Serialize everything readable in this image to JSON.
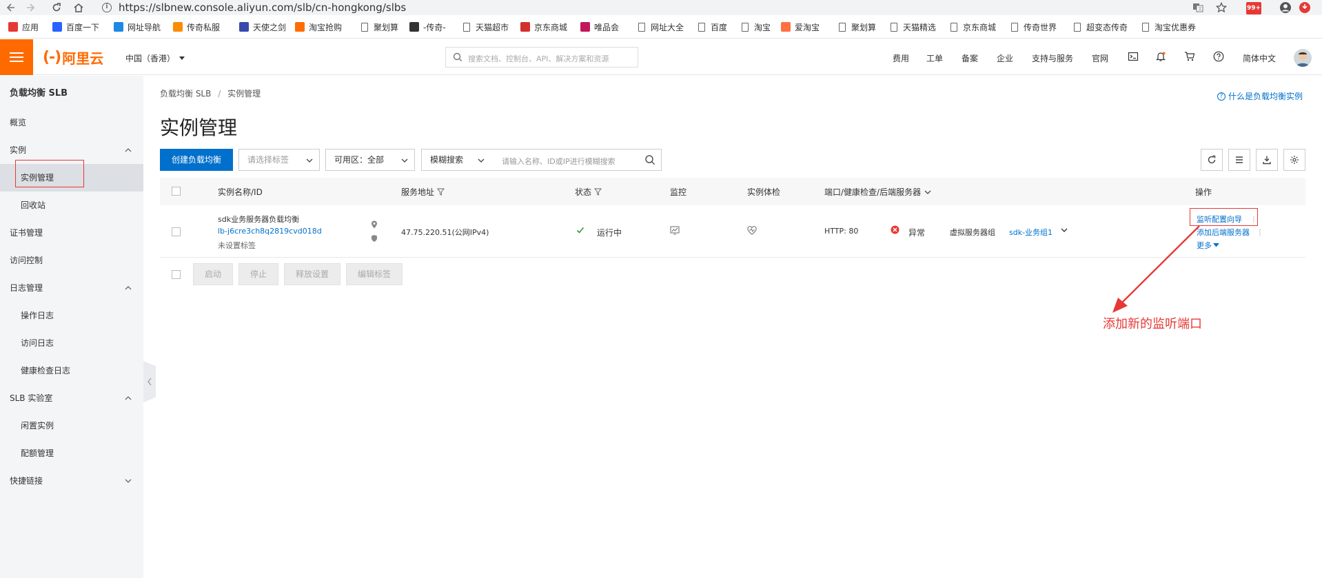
{
  "browser": {
    "url": "https://slbnew.console.aliyun.com/slb/cn-hongkong/slbs",
    "notification_badge": "99+",
    "bookmarks": [
      {
        "label": "应用",
        "icon": "apps-grid-icon",
        "color": "#e53935"
      },
      {
        "label": "百度一下",
        "icon": "baidu-icon",
        "color": "#2962ff"
      },
      {
        "label": "网址导航",
        "icon": "nav-site-icon",
        "color": "#1e88e5"
      },
      {
        "label": "传奇私服",
        "icon": "game-icon",
        "color": "#fb8c00"
      },
      {
        "label": "天使之剑",
        "icon": "angel-icon",
        "color": "#3949ab"
      },
      {
        "label": "淘宝抢购",
        "icon": "taobao-icon",
        "color": "#ff6d00"
      },
      {
        "label": "聚划算",
        "icon": "page-icon",
        "color": ""
      },
      {
        "label": "-传奇-",
        "icon": "legend-icon",
        "color": "#333333"
      },
      {
        "label": "天猫超市",
        "icon": "page-icon",
        "color": ""
      },
      {
        "label": "京东商城",
        "icon": "jd-icon",
        "color": "#d32f2f"
      },
      {
        "label": "唯品会",
        "icon": "vip-icon",
        "color": "#c2185b"
      },
      {
        "label": "网址大全",
        "icon": "page-icon",
        "color": ""
      },
      {
        "label": "百度",
        "icon": "page-icon",
        "color": ""
      },
      {
        "label": "淘宝",
        "icon": "page-icon",
        "color": ""
      },
      {
        "label": "爱淘宝",
        "icon": "aitaobao-icon",
        "color": "#ff7043"
      },
      {
        "label": "聚划算",
        "icon": "page-icon",
        "color": ""
      },
      {
        "label": "天猫精选",
        "icon": "page-icon",
        "color": ""
      },
      {
        "label": "京东商城",
        "icon": "page-icon",
        "color": ""
      },
      {
        "label": "传奇世界",
        "icon": "page-icon",
        "color": ""
      },
      {
        "label": "超变态传奇",
        "icon": "page-icon",
        "color": ""
      },
      {
        "label": "淘宝优惠券",
        "icon": "page-icon",
        "color": ""
      }
    ]
  },
  "header": {
    "logo_text": "阿里云",
    "logo_bracket": "(-)",
    "region": "中国（香港）",
    "search_placeholder": "搜索文档、控制台、API、解决方案和资源",
    "nav": [
      "费用",
      "工单",
      "备案",
      "企业",
      "支持与服务",
      "官网"
    ],
    "language": "简体中文"
  },
  "sidebar": {
    "title": "负载均衡 SLB",
    "items": [
      {
        "label": "概览",
        "level": 1
      },
      {
        "label": "实例",
        "level": 1,
        "expandable": true
      },
      {
        "label": "实例管理",
        "level": 2,
        "active": true
      },
      {
        "label": "回收站",
        "level": 2
      },
      {
        "label": "证书管理",
        "level": 1
      },
      {
        "label": "访问控制",
        "level": 1
      },
      {
        "label": "日志管理",
        "level": 1,
        "expandable": true
      },
      {
        "label": "操作日志",
        "level": 2
      },
      {
        "label": "访问日志",
        "level": 2
      },
      {
        "label": "健康检查日志",
        "level": 2
      },
      {
        "label": "SLB 实验室",
        "level": 1,
        "expandable": true
      },
      {
        "label": "闲置实例",
        "level": 2
      },
      {
        "label": "配额管理",
        "level": 2
      },
      {
        "label": "快捷链接",
        "level": 1,
        "expandable": true,
        "collapsed": true
      }
    ]
  },
  "main": {
    "breadcrumb": {
      "root": "负载均衡 SLB",
      "sep": "/",
      "current": "实例管理"
    },
    "help_link": "什么是负载均衡实例",
    "title": "实例管理",
    "toolbar": {
      "create_button": "创建负载均衡",
      "tag_select": "请选择标签",
      "zone_select": "可用区：全部",
      "search_mode": "模糊搜索",
      "search_placeholder": "请输入名称、ID或IP进行模糊搜索"
    },
    "table": {
      "columns": [
        "实例名称/ID",
        "服务地址",
        "状态",
        "监控",
        "实例体检",
        "端口/健康检查/后端服务器",
        "操作"
      ],
      "rows": [
        {
          "name": "sdk业务服务器负载均衡",
          "id": "lb-j6cre3ch8q2819cvd018d",
          "tags": "未设置标签",
          "address": "47.75.220.51(公网IPv4)",
          "status": "运行中",
          "port": "HTTP:  80",
          "health": "异常",
          "server_group_label": "虚拟服务器组",
          "server_group": "sdk-业务组1",
          "actions": {
            "listener_wizard": "监听配置向导",
            "add_backend": "添加后端服务器",
            "more": "更多"
          }
        }
      ]
    },
    "batch_buttons": [
      "启动",
      "停止",
      "释放设置",
      "编辑标签"
    ]
  },
  "annotation": {
    "text": "添加新的监听端口",
    "color": "#e53935"
  },
  "colors": {
    "brand": "#ff6a00",
    "primary": "#0070cc",
    "success": "#2e9a2e",
    "error": "#e53935"
  }
}
